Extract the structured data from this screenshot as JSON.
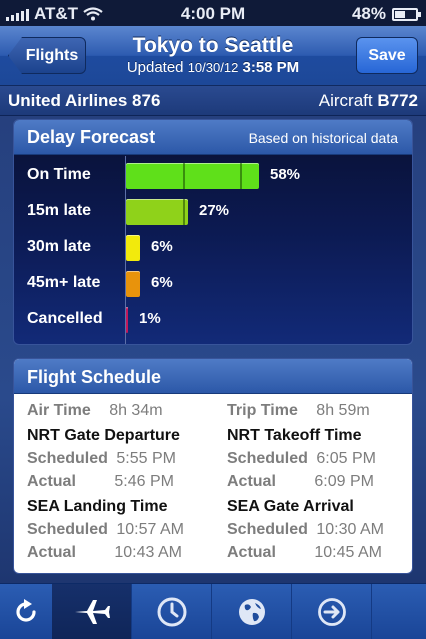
{
  "status_bar": {
    "carrier": "AT&T",
    "time": "4:00 PM",
    "battery": "48%",
    "battery_level": 0.48
  },
  "nav": {
    "back_label": "Flights",
    "title": "Tokyo to Seattle",
    "updated_prefix": "Updated",
    "updated_date": "10/30/12",
    "updated_time": "3:58 PM",
    "save_label": "Save"
  },
  "flight": {
    "airline": "United Airlines 876",
    "aircraft_label": "Aircraft",
    "aircraft_code": "B772"
  },
  "delay_forecast": {
    "title": "Delay Forecast",
    "note": "Based on historical data",
    "rows": [
      {
        "label": "On Time",
        "pct": "58%",
        "value": 58,
        "color": "#5fe01a"
      },
      {
        "label": "15m late",
        "pct": "27%",
        "value": 27,
        "color": "#8fd21a"
      },
      {
        "label": "30m late",
        "pct": "6%",
        "value": 6,
        "color": "#f2ea0c"
      },
      {
        "label": "45m+ late",
        "pct": "6%",
        "value": 6,
        "color": "#e8930c"
      },
      {
        "label": "Cancelled",
        "pct": "1%",
        "value": 1,
        "color": "#c2185b"
      }
    ]
  },
  "schedule": {
    "title": "Flight Schedule",
    "air_time_label": "Air Time",
    "air_time": "8h 34m",
    "trip_time_label": "Trip Time",
    "trip_time": "8h 59m",
    "nrt_gate_departure": "NRT Gate Departure",
    "nrt_takeoff": "NRT Takeoff Time",
    "sea_landing": "SEA Landing Time",
    "sea_gate_arrival": "SEA Gate Arrival",
    "scheduled_label": "Scheduled",
    "actual_label": "Actual",
    "dep_scheduled": "5:55 PM",
    "dep_actual": "5:46 PM",
    "takeoff_scheduled": "6:05 PM",
    "takeoff_actual": "6:09 PM",
    "landing_scheduled": "10:57 AM",
    "landing_actual": "10:43 AM",
    "arrival_scheduled": "10:30 AM",
    "arrival_actual": "10:45 AM"
  },
  "tabs": [
    {
      "name": "refresh-icon"
    },
    {
      "name": "airplane-icon"
    },
    {
      "name": "clock-icon"
    },
    {
      "name": "globe-icon"
    },
    {
      "name": "arrow-right-circle-icon"
    }
  ]
}
